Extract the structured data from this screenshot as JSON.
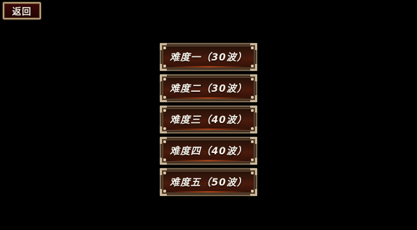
{
  "header": {
    "back_label": "返回",
    "back_icon": "back-button"
  },
  "difficulty": {
    "items": [
      {
        "label": "难度一（30波）"
      },
      {
        "label": "难度二（30波）"
      },
      {
        "label": "难度三（40波）"
      },
      {
        "label": "难度四（40波）"
      },
      {
        "label": "难度五（50波）"
      }
    ]
  },
  "colors": {
    "background": "#000000",
    "button_fill": "#3c170c",
    "frame": "#7d6a52",
    "text": "#f6f1e8"
  }
}
